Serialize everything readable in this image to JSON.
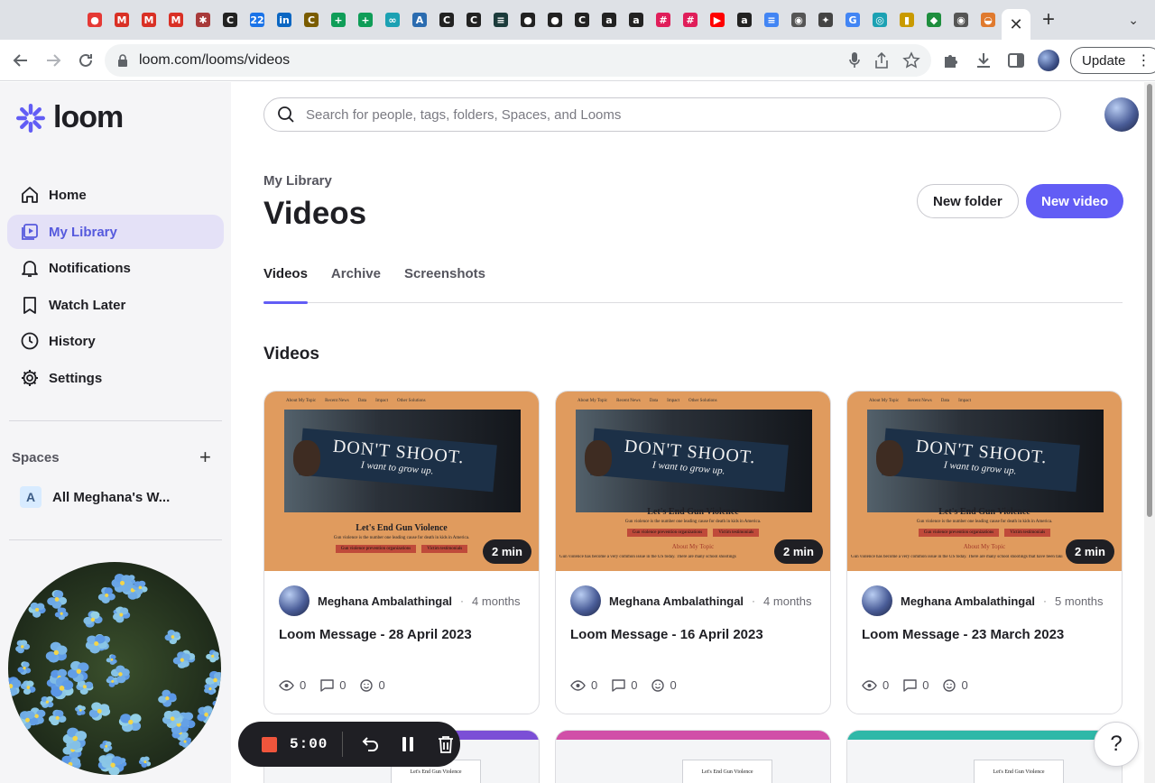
{
  "browser": {
    "url": "loom.com/looms/videos",
    "update_label": "Update",
    "tab_favicons": [
      {
        "icon": "record-icon",
        "color": "#e53935",
        "glyph": "●"
      },
      {
        "icon": "gmail-icon",
        "color": "#d93025",
        "glyph": "M"
      },
      {
        "icon": "gmail-icon",
        "color": "#d93025",
        "glyph": "M"
      },
      {
        "icon": "gmail-icon",
        "color": "#d93025",
        "glyph": "M"
      },
      {
        "icon": "bug-icon",
        "color": "#a83a3a",
        "glyph": "✱"
      },
      {
        "icon": "c-icon",
        "color": "#222222",
        "glyph": "C"
      },
      {
        "icon": "calendar-icon",
        "color": "#1a73e8",
        "glyph": "22"
      },
      {
        "icon": "linkedin-icon",
        "color": "#0a66c2",
        "glyph": "in"
      },
      {
        "icon": "coin-icon",
        "color": "#7a5c00",
        "glyph": "C"
      },
      {
        "icon": "sheets-icon",
        "color": "#0f9d58",
        "glyph": "+"
      },
      {
        "icon": "sheets-icon",
        "color": "#0f9d58",
        "glyph": "+"
      },
      {
        "icon": "link-icon",
        "color": "#1ca1b3",
        "glyph": "∞"
      },
      {
        "icon": "app-icon",
        "color": "#2b6cb0",
        "glyph": "A"
      },
      {
        "icon": "c-icon",
        "color": "#222222",
        "glyph": "C"
      },
      {
        "icon": "c-icon",
        "color": "#222222",
        "glyph": "C"
      },
      {
        "icon": "codepath-icon",
        "color": "#1b3b3b",
        "glyph": "≡"
      },
      {
        "icon": "github-icon",
        "color": "#222222",
        "glyph": "●"
      },
      {
        "icon": "github-icon",
        "color": "#222222",
        "glyph": "●"
      },
      {
        "icon": "c-icon",
        "color": "#222222",
        "glyph": "C"
      },
      {
        "icon": "amazon-icon",
        "color": "#222222",
        "glyph": "a"
      },
      {
        "icon": "amazon-icon",
        "color": "#222222",
        "glyph": "a"
      },
      {
        "icon": "slack-icon",
        "color": "#e01e5a",
        "glyph": "#"
      },
      {
        "icon": "slack-icon",
        "color": "#e01e5a",
        "glyph": "#"
      },
      {
        "icon": "youtube-icon",
        "color": "#ff0000",
        "glyph": "▶"
      },
      {
        "icon": "amazon-icon",
        "color": "#222222",
        "glyph": "a"
      },
      {
        "icon": "docs-icon",
        "color": "#4285f4",
        "glyph": "≡"
      },
      {
        "icon": "globe-icon",
        "color": "#555555",
        "glyph": "◉"
      },
      {
        "icon": "person-icon",
        "color": "#444444",
        "glyph": "✦"
      },
      {
        "icon": "google-icon",
        "color": "#4285f4",
        "glyph": "G"
      },
      {
        "icon": "eye-icon",
        "color": "#1ca1b3",
        "glyph": "◎"
      },
      {
        "icon": "trophy-icon",
        "color": "#c99a00",
        "glyph": "▮"
      },
      {
        "icon": "chart-icon",
        "color": "#1e8e3e",
        "glyph": "◆"
      },
      {
        "icon": "globe-icon",
        "color": "#555555",
        "glyph": "◉"
      },
      {
        "icon": "loom-favicon-icon",
        "color": "#e07a2e",
        "glyph": "◒"
      }
    ]
  },
  "sidebar": {
    "brand": "loom",
    "nav": [
      {
        "label": "Home",
        "icon": "home-icon",
        "active": false
      },
      {
        "label": "My Library",
        "icon": "library-icon",
        "active": true
      },
      {
        "label": "Notifications",
        "icon": "bell-icon",
        "active": false
      },
      {
        "label": "Watch Later",
        "icon": "bookmark-icon",
        "active": false
      },
      {
        "label": "History",
        "icon": "clock-icon",
        "active": false
      },
      {
        "label": "Settings",
        "icon": "gear-icon",
        "active": false
      }
    ],
    "spaces_label": "Spaces",
    "space_badge": "A",
    "space_name": "All Meghana's W..."
  },
  "main": {
    "search_placeholder": "Search for people, tags, folders, Spaces, and Looms",
    "breadcrumb": "My Library",
    "title": "Videos",
    "new_folder_label": "New folder",
    "new_video_label": "New video",
    "tabs": [
      {
        "label": "Videos",
        "active": true
      },
      {
        "label": "Archive",
        "active": false
      },
      {
        "label": "Screenshots",
        "active": false
      }
    ],
    "section_title": "Videos",
    "cards": [
      {
        "duration": "2 min",
        "author": "Meghana Ambalathingal",
        "age": "4 months",
        "title": "Loom Message - 28 April 2023",
        "views": "0",
        "comments": "0",
        "reactions": "0",
        "thumb": {
          "nav": [
            "About My Topic",
            "Recent News",
            "Data",
            "Impact",
            "Other Solutions"
          ],
          "sign_big": "DON'T SHOOT.",
          "sign_small": "I want to grow up.",
          "heading": "Let's End Gun Violence",
          "sub": "Gun violence is the number one leading cause for death in kids in America.",
          "btns": [
            "Gun violence prevention organizations",
            "Victim testimonials"
          ],
          "topic": "",
          "para": ""
        }
      },
      {
        "duration": "2 min",
        "author": "Meghana Ambalathingal",
        "age": "4 months",
        "title": "Loom Message - 16 April 2023",
        "views": "0",
        "comments": "0",
        "reactions": "0",
        "thumb": {
          "nav": [
            "About My Topic",
            "Recent News",
            "Data",
            "Impact",
            "Other Solutions"
          ],
          "sign_big": "DON'T SHOOT.",
          "sign_small": "I want to grow up.",
          "heading": "Let's End Gun Violence",
          "sub": "Gun violence is the number one leading cause for death in kids in America.",
          "btns": [
            "Gun violence prevention organizations",
            "Victim testimonials"
          ],
          "topic": "About My Topic",
          "para": "Gun violence has become a very common issue in the US today. There are many school shootings"
        }
      },
      {
        "duration": "2 min",
        "author": "Meghana Ambalathingal",
        "age": "5 months",
        "title": "Loom Message - 23 March 2023",
        "views": "0",
        "comments": "0",
        "reactions": "0",
        "thumb": {
          "nav": [
            "About My Topic",
            "Recent News",
            "Data",
            "Impact"
          ],
          "sign_big": "DON'T SHOOT.",
          "sign_small": "I want to grow up.",
          "heading": "Let's End Gun Violence",
          "sub": "Gun violence is the number one leading cause for death in kids in America.",
          "btns": [
            "Gun violence prevention organizations",
            "Victim testimonials"
          ],
          "topic": "About My Topic",
          "para": "Gun violence has become a very common issue in the US today. There are many school shootings that have been taki"
        }
      }
    ],
    "peek_cards": [
      {
        "heading": "Let's End Gun Violence",
        "accent": "#7b4fd6"
      },
      {
        "heading": "Let's End Gun Violence",
        "accent": "#d14fa8"
      },
      {
        "heading": "Let's End Gun Violence",
        "accent": "#2fb8a8"
      }
    ]
  },
  "recorder": {
    "time": "5:00"
  },
  "help_label": "?",
  "colors": {
    "brand": "#625df5",
    "active_nav_bg": "#e4e1f7",
    "active_nav_text": "#565add",
    "record_stop": "#f0553c"
  }
}
